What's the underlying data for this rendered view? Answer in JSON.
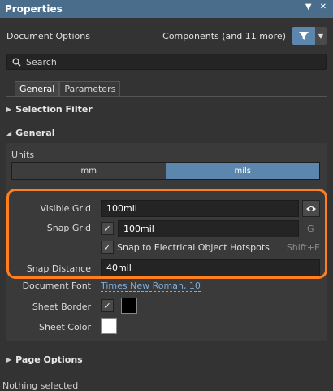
{
  "titlebar": {
    "title": "Properties",
    "dropdown_icon": "chevron-down-icon",
    "close_icon": "close-icon"
  },
  "header": {
    "document_options": "Document Options",
    "components_filter": "Components (and 11 more)",
    "filter_icon": "filter-icon"
  },
  "search": {
    "placeholder": "Search"
  },
  "tabs": [
    {
      "label": "General",
      "active": true
    },
    {
      "label": "Parameters",
      "active": false
    }
  ],
  "sections": {
    "selection_filter": "Selection Filter",
    "general": "General",
    "page_options": "Page Options"
  },
  "units": {
    "label": "Units",
    "options": [
      "mm",
      "mils"
    ],
    "selected": "mils"
  },
  "grid": {
    "visible_grid_label": "Visible Grid",
    "visible_grid_value": "100mil",
    "snap_grid_label": "Snap Grid",
    "snap_grid_checked": true,
    "snap_grid_value": "100mil",
    "snap_grid_shortcut": "G",
    "snap_hotspots_label": "Snap to Electrical Object Hotspots",
    "snap_hotspots_checked": true,
    "snap_hotspots_shortcut": "Shift+E",
    "snap_distance_label": "Snap Distance",
    "snap_distance_value": "40mil"
  },
  "sheet": {
    "document_font_label": "Document Font",
    "document_font_value": "Times New Roman, 10",
    "sheet_border_label": "Sheet Border",
    "sheet_border_checked": true,
    "sheet_border_color": "#000000",
    "sheet_color_label": "Sheet Color",
    "sheet_color": "#ffffff"
  },
  "status": "Nothing selected",
  "colors": {
    "accent": "#5c86ad",
    "highlight": "#ff7f1e",
    "link": "#7faedb"
  }
}
